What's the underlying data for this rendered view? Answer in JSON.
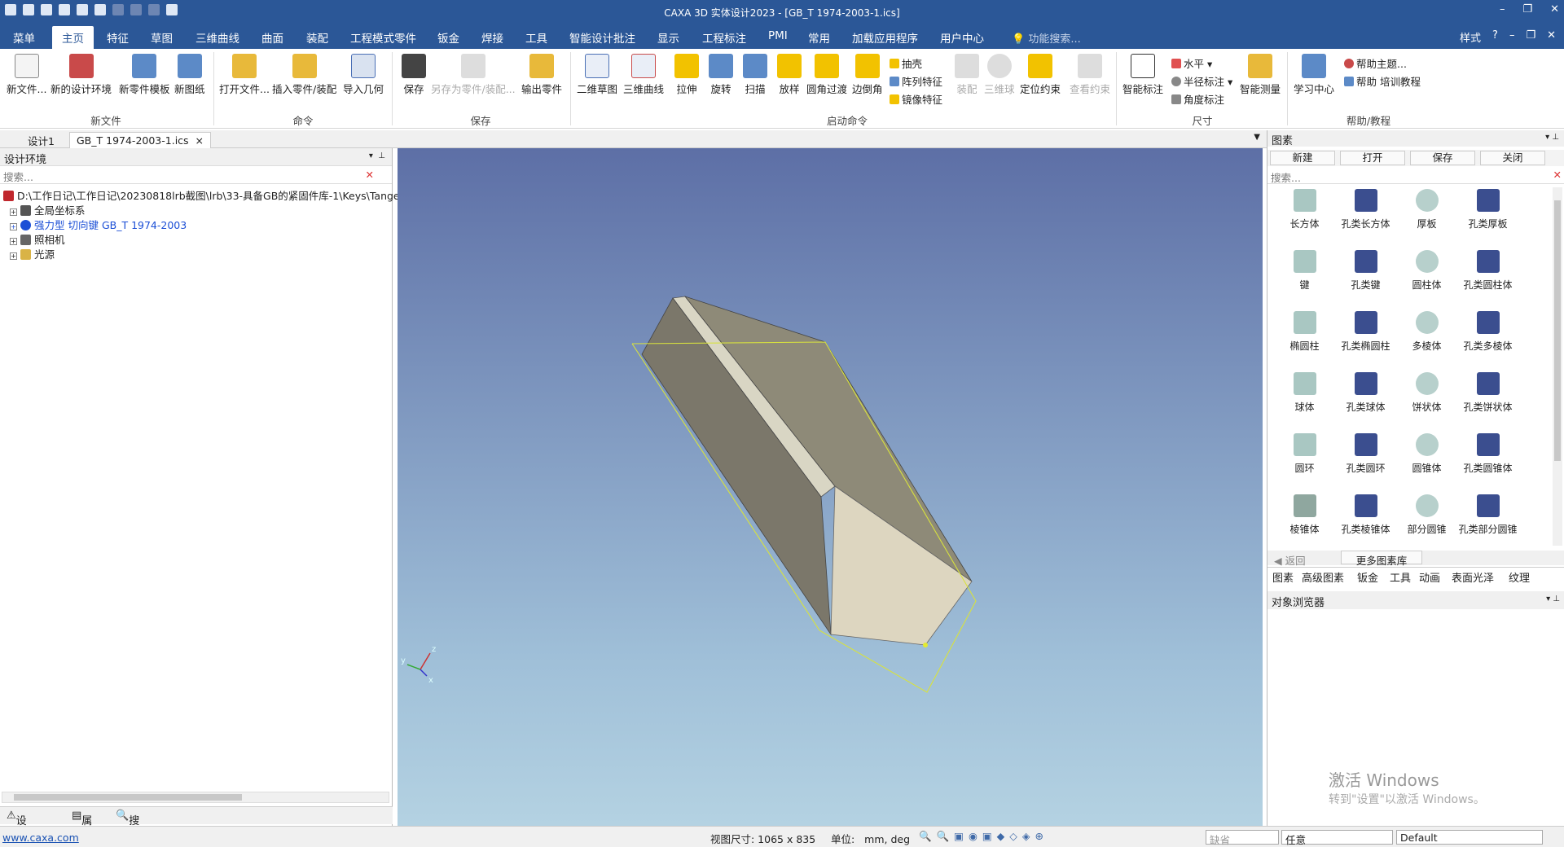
{
  "titlebar": {
    "title": "CAXA 3D 实体设计2023 - [GB_T 1974-2003-1.ics]",
    "min": "–",
    "restore": "❐",
    "close": "✕"
  },
  "menu": {
    "tabs": [
      "菜单",
      "主页",
      "特征",
      "草图",
      "三维曲线",
      "曲面",
      "装配",
      "工程模式零件",
      "钣金",
      "焊接",
      "工具",
      "智能设计批注",
      "显示",
      "工程标注",
      "PMI",
      "常用",
      "加载应用程序",
      "用户中心"
    ],
    "search_placeholder": "功能搜索...",
    "style": "样式",
    "help": "?"
  },
  "ribbon": {
    "new_file": "新文件...",
    "new_design": "新的设计环境",
    "new_part_template": "新零件模板",
    "new_drawing": "新图纸",
    "open_file": "打开文件...",
    "insert_part": "插入零件/装配",
    "import_geom": "导入几何",
    "save": "保存",
    "save_as_part": "另存为零件/装配...",
    "export_part": "输出零件",
    "sketch2d": "二维草图",
    "curve3d": "三维曲线",
    "extrude": "拉伸",
    "revolve": "旋转",
    "sweep": "扫描",
    "loft": "放样",
    "fillet": "圆角过渡",
    "chamfer": "边倒角",
    "shell": "抽壳",
    "pattern": "阵列特征",
    "mirror": "镜像特征",
    "assembly": "装配",
    "ball3d": "三维球",
    "constraint": "定位约束",
    "view_constraint": "查看约束",
    "smart_dim": "智能标注",
    "horizontal": "水平",
    "radius_dim": "半径标注",
    "angle_dim": "角度标注",
    "smart_measure": "智能测量",
    "learn_center": "学习中心",
    "help_topics": "帮助主题...",
    "help_training": "帮助 培训教程",
    "groups": {
      "new_file": "新文件",
      "command": "命令",
      "save": "保存",
      "start_cmd": "启动命令",
      "size": "尺寸",
      "help": "帮助/教程"
    }
  },
  "doc_tabs": {
    "tab1": "设计1",
    "tab2": "GB_T 1974-2003-1.ics",
    "close": "×"
  },
  "left_panel": {
    "title": "设计环境",
    "search_placeholder": "搜索...",
    "tree": [
      {
        "label": "D:\\工作日记\\工作日记\\20230818lrb截图\\lrb\\33-具备GB的紧固件库-1\\Keys\\Tanger",
        "color": "#c0272d"
      },
      {
        "label": "全局坐标系",
        "color": "#333"
      },
      {
        "label": "强力型 切向键 GB_T 1974-2003",
        "color": "#1c4fd6"
      },
      {
        "label": "照相机",
        "color": "#555"
      },
      {
        "label": "光源",
        "color": "#a07a1c"
      }
    ],
    "bottom_tabs": [
      "设计环境",
      "属性",
      "搜索"
    ]
  },
  "viewport": {
    "axis_z": "z",
    "axis_y": "y",
    "axis_x": "x"
  },
  "right_panel": {
    "title": "图素",
    "toolbar": [
      "新建",
      "打开",
      "保存",
      "关闭"
    ],
    "search_placeholder": "搜索...",
    "items": [
      {
        "label": "长方体",
        "color": "#a9c7c2"
      },
      {
        "label": "孔类长方体",
        "color": "#3b4e8f"
      },
      {
        "label": "厚板",
        "color": "#b7d0cc"
      },
      {
        "label": "孔类厚板",
        "color": "#3b4e8f"
      },
      {
        "label": "键",
        "color": "#a9c7c2"
      },
      {
        "label": "孔类键",
        "color": "#3b4e8f"
      },
      {
        "label": "圆柱体",
        "color": "#b7d0cc"
      },
      {
        "label": "孔类圆柱体",
        "color": "#3b4e8f"
      },
      {
        "label": "椭圆柱",
        "color": "#a9c7c2"
      },
      {
        "label": "孔类椭圆柱",
        "color": "#3b4e8f"
      },
      {
        "label": "多棱体",
        "color": "#b7d0cc"
      },
      {
        "label": "孔类多棱体",
        "color": "#3b4e8f"
      },
      {
        "label": "球体",
        "color": "#a9c7c2"
      },
      {
        "label": "孔类球体",
        "color": "#3b4e8f"
      },
      {
        "label": "饼状体",
        "color": "#b7d0cc"
      },
      {
        "label": "孔类饼状体",
        "color": "#3b4e8f"
      },
      {
        "label": "圆环",
        "color": "#a9c7c2"
      },
      {
        "label": "孔类圆环",
        "color": "#3b4e8f"
      },
      {
        "label": "圆锥体",
        "color": "#b7d0cc"
      },
      {
        "label": "孔类圆锥体",
        "color": "#3b4e8f"
      },
      {
        "label": "棱锥体",
        "color": "#8fa79f"
      },
      {
        "label": "孔类棱锥体",
        "color": "#3b4e8f"
      },
      {
        "label": "部分圆锥",
        "color": "#b7d0cc"
      },
      {
        "label": "孔类部分圆锥",
        "color": "#3b4e8f"
      }
    ],
    "nav_back": "返回",
    "nav_more": "更多图素库",
    "tabs": [
      "图素",
      "高级图素",
      "钣金",
      "工具",
      "动画",
      "表面光泽",
      "纹理"
    ],
    "object_browser": "对象浏览器",
    "watermark_title": "激活 Windows",
    "watermark_sub": "转到\"设置\"以激活 Windows。"
  },
  "statusbar": {
    "link": "www.caxa.com",
    "view_size": "视图尺寸: 1065 x  835",
    "unit_label": "单位:",
    "unit_value": "mm, deg",
    "mode": "缺省",
    "filter": "任意",
    "style": "Default"
  }
}
